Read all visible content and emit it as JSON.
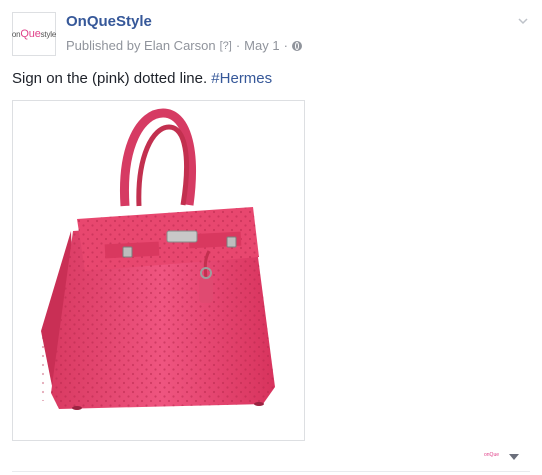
{
  "post": {
    "avatar": {
      "logo_prefix": "on",
      "logo_accent": "Que",
      "logo_suffix": "style"
    },
    "page_name": "OnQueStyle",
    "publisher": "Published by Elan Carson",
    "help_marker": "[?]",
    "separator": "·",
    "date": "May 1",
    "privacy_icon": "globe-icon",
    "options_icon": "chevron-down-icon",
    "text": "Sign on the (pink) dotted line.",
    "hashtag": "#Hermes",
    "photo": {
      "subject": "handbag",
      "color": "#e8476f"
    },
    "footer": {
      "logo": "onQue",
      "caret_icon": "caret-down-icon"
    }
  },
  "colors": {
    "link": "#365899",
    "meta": "#90949c",
    "brand_pink": "#e0428a",
    "bag_pink": "#e8476f"
  }
}
